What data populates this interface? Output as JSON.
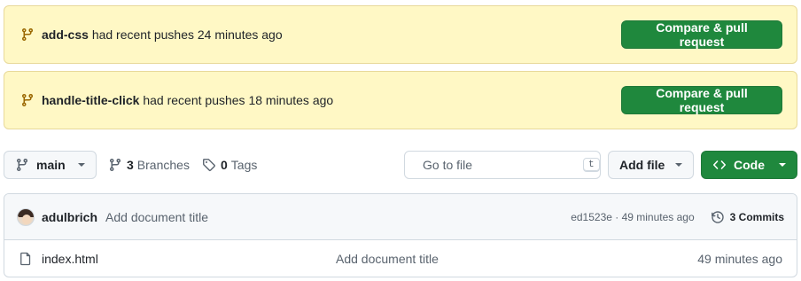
{
  "banners": [
    {
      "branch": "add-css",
      "message": "had recent pushes 24 minutes ago",
      "button": "Compare & pull request"
    },
    {
      "branch": "handle-title-click",
      "message": "had recent pushes 18 minutes ago",
      "button": "Compare & pull request"
    }
  ],
  "toolbar": {
    "branch": "main",
    "branches_count": "3",
    "branches_label": "Branches",
    "tags_count": "0",
    "tags_label": "Tags",
    "search_placeholder": "Go to file",
    "search_shortcut": "t",
    "add_file": "Add file",
    "code": "Code"
  },
  "latest_commit": {
    "author": "adulbrich",
    "message": "Add document title",
    "meta": "ed1523e · 49 minutes ago",
    "commits_label": "3 Commits"
  },
  "files": [
    {
      "name": "index.html",
      "commit": "Add document title",
      "age": "49 minutes ago"
    }
  ],
  "colors": {
    "banner_bg": "#fff8c5",
    "primary_green": "#1f883d",
    "muted_text": "#59636e"
  },
  "icons": [
    "git-branch-icon",
    "tag-icon",
    "search-icon",
    "code-icon",
    "history-icon",
    "file-icon"
  ]
}
